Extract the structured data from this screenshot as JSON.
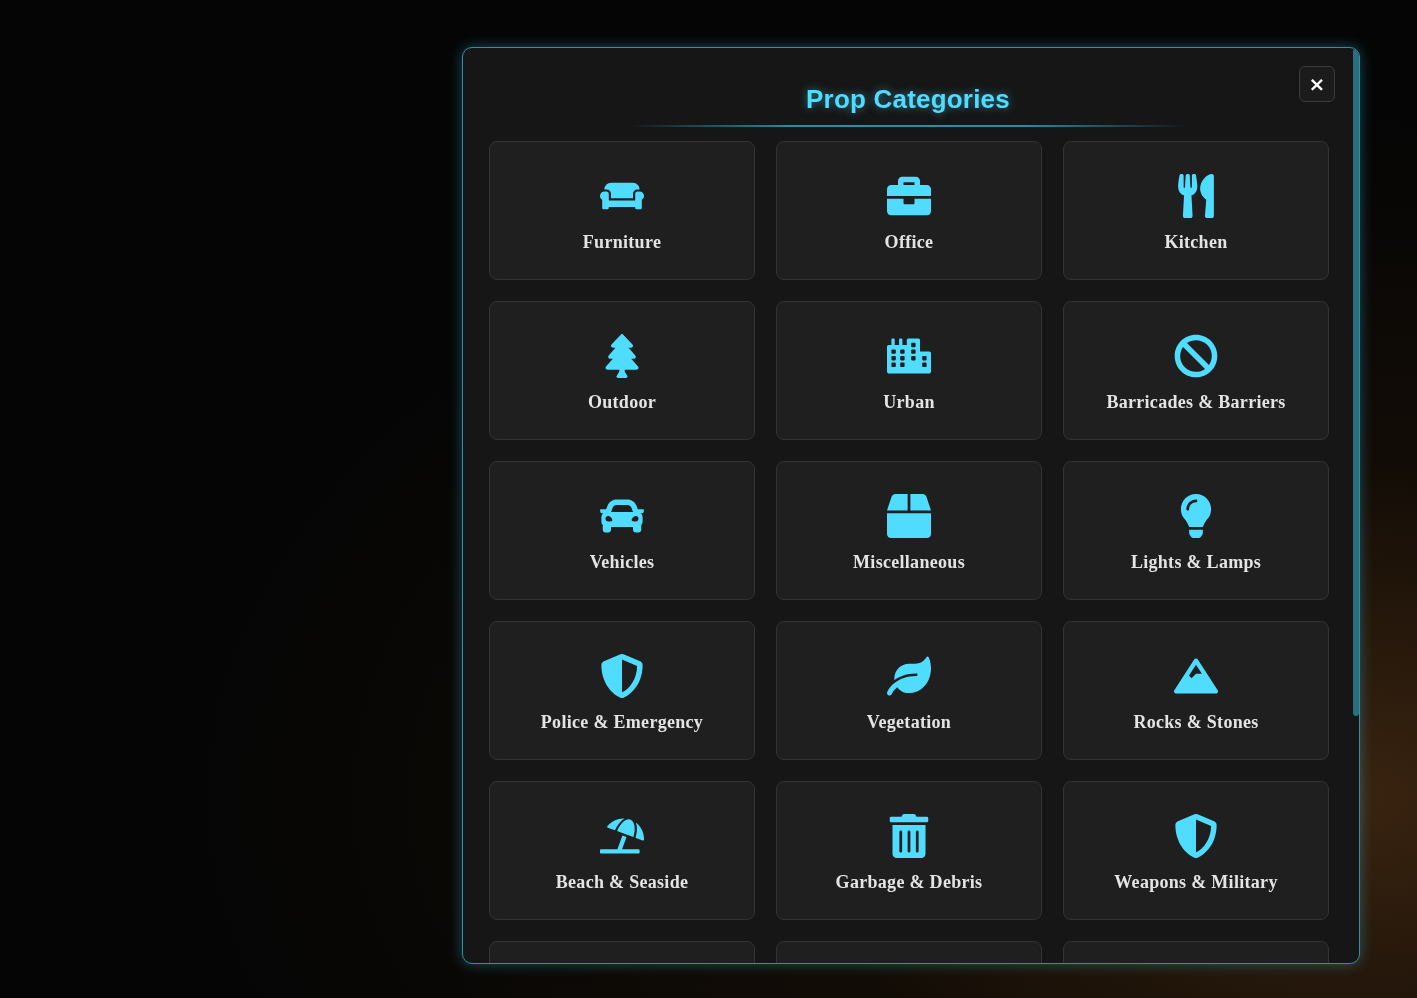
{
  "dialog": {
    "title": "Prop Categories",
    "close_label": "×"
  },
  "categories": [
    {
      "kind": "category",
      "label": "Furniture"
    },
    {
      "kind": "category",
      "label": "Office"
    },
    {
      "kind": "category",
      "label": "Kitchen"
    },
    {
      "kind": "category",
      "label": "Outdoor"
    },
    {
      "kind": "category",
      "label": "Urban"
    },
    {
      "kind": "category",
      "label": "Barricades & Barriers"
    },
    {
      "kind": "category",
      "label": "Vehicles"
    },
    {
      "kind": "category",
      "label": "Miscellaneous"
    },
    {
      "kind": "category",
      "label": "Lights & Lamps"
    },
    {
      "kind": "category",
      "label": "Police & Emergency"
    },
    {
      "kind": "category",
      "label": "Vegetation"
    },
    {
      "kind": "category",
      "label": "Rocks & Stones"
    },
    {
      "kind": "category",
      "label": "Beach & Seaside"
    },
    {
      "kind": "category",
      "label": "Garbage & Debris"
    },
    {
      "kind": "category",
      "label": "Weapons & Military"
    },
    {
      "kind": "clipped"
    },
    {
      "kind": "clipped"
    },
    {
      "kind": "clipped"
    }
  ]
}
